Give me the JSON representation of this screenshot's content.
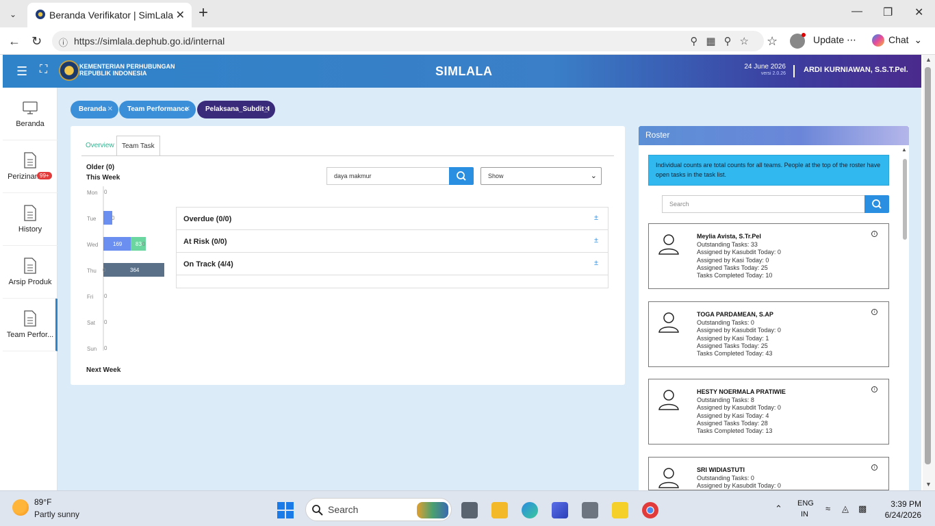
{
  "browser": {
    "tab_title": "Beranda Verifikator | SimLala",
    "url": "https://simlala.dephub.go.id/internal",
    "update_label": "Update",
    "chat_label": "Chat"
  },
  "header": {
    "org_line1": "KEMENTERIAN PERHUBUNGAN",
    "org_line2": "REPUBLIK INDONESIA",
    "title": "SIMLALA",
    "date": "24 June 2026",
    "version": "versi 2.0.26",
    "user": "ARDI KURNIAWAN, S.S.T.Pel."
  },
  "sidebar": {
    "items": [
      {
        "label": "Beranda",
        "icon": "monitor-icon"
      },
      {
        "label": "Perizinan",
        "icon": "document-icon",
        "badge": "99+"
      },
      {
        "label": "History",
        "icon": "document-icon"
      },
      {
        "label": "Arsip Produk",
        "icon": "document-icon"
      },
      {
        "label": "Team Perfor...",
        "icon": "document-icon"
      }
    ]
  },
  "breadcrumbs": [
    "Beranda",
    "Team Performance",
    "Pelaksana_Subdit_I"
  ],
  "panel": {
    "tabs": [
      "Overview",
      "Team Task"
    ],
    "active_tab": "Team Task",
    "older": "Older (0)",
    "this_week": "This Week",
    "next_week": "Next Week",
    "search_value": "daya makmur",
    "show_select": "Show",
    "accordion": [
      {
        "title": "Overdue (0/0)"
      },
      {
        "title": "At Risk (0/0)"
      },
      {
        "title": "On Track (4/4)"
      }
    ]
  },
  "chart_data": {
    "type": "bar",
    "orientation": "horizontal-stacked",
    "categories": [
      "Mon",
      "Tue",
      "Wed",
      "Thu",
      "Fri",
      "Sat",
      "Sun"
    ],
    "series": [
      {
        "values": [
          0,
          0,
          169,
          0,
          0,
          0,
          0
        ],
        "color": "#6a8ff0"
      },
      {
        "values": [
          0,
          0,
          83,
          364,
          0,
          0,
          0
        ],
        "color": "#6bd6a0"
      }
    ],
    "data_labels": [
      [
        "0"
      ],
      [
        "0"
      ],
      [
        "169",
        "83",
        "0"
      ],
      [
        "0",
        "364"
      ],
      [
        "0"
      ],
      [
        "0"
      ],
      [
        "0"
      ]
    ]
  },
  "roster": {
    "title": "Roster",
    "info": "Individual counts are total counts for all teams. People at the top of the roster have open tasks in the task list.",
    "search_placeholder": "Search",
    "people": [
      {
        "name": "Meylia Avista, S.Tr.Pel",
        "lines": [
          "Outstanding Tasks: 33",
          "Assigned by Kasubdit Today: 0",
          "Assigned by Kasi Today: 0",
          "Assigned Tasks Today: 25",
          "Tasks Completed Today: 10"
        ]
      },
      {
        "name": "TOGA PARDAMEAN, S.AP",
        "lines": [
          "Outstanding Tasks: 0",
          "Assigned by Kasubdit Today: 0",
          "Assigned by Kasi Today: 1",
          "Assigned Tasks Today: 25",
          "Tasks Completed Today: 43"
        ]
      },
      {
        "name": "HESTY NOERMALA PRATIWIE",
        "lines": [
          "Outstanding Tasks: 8",
          "Assigned by Kasubdit Today: 0",
          "Assigned by Kasi Today: 4",
          "Assigned Tasks Today: 28",
          "Tasks Completed Today: 13"
        ]
      },
      {
        "name": "SRI WIDIASTUTI",
        "lines": [
          "Outstanding Tasks: 0",
          "Assigned by Kasubdit Today: 0"
        ]
      }
    ]
  },
  "taskbar": {
    "temp": "89°F",
    "condition": "Partly sunny",
    "search": "Search",
    "lang1": "ENG",
    "lang2": "IN",
    "time": "3:39 PM",
    "date": "6/24/2026"
  }
}
